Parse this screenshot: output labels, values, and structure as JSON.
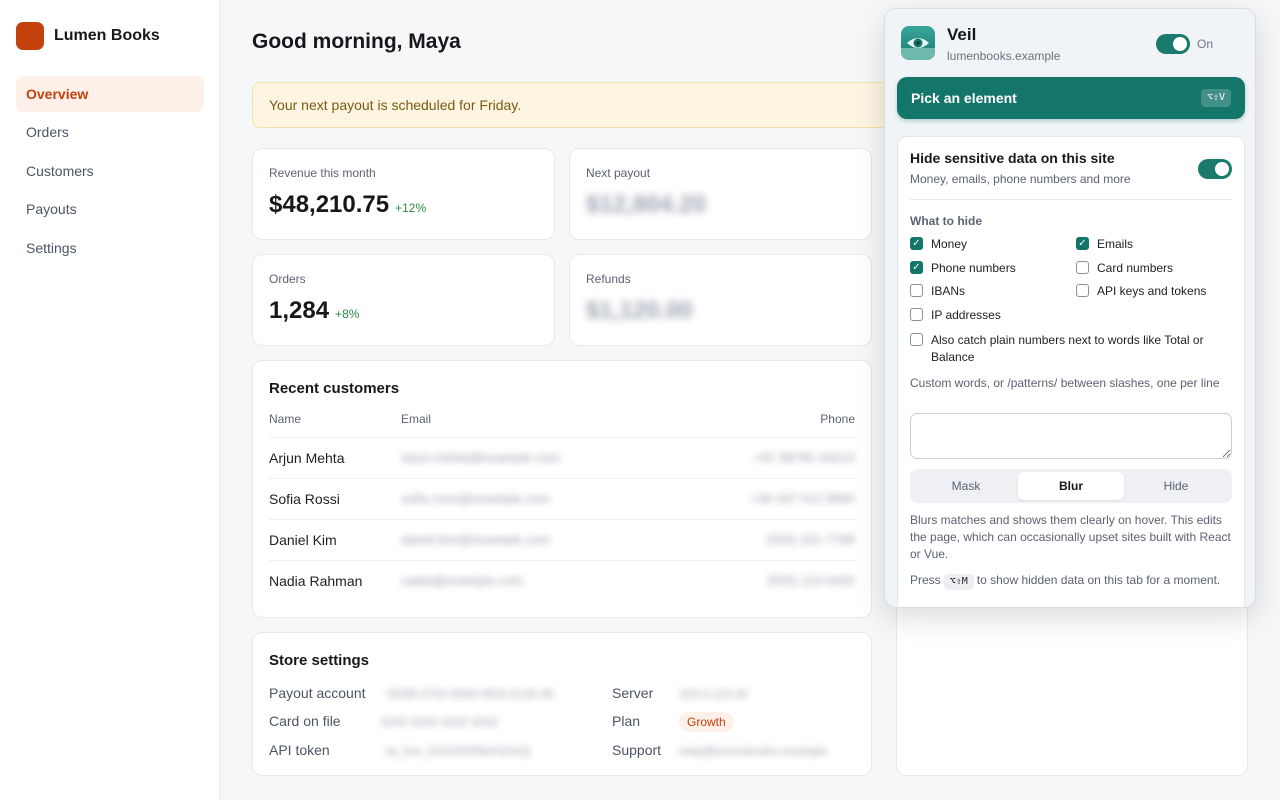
{
  "app": {
    "name": "Lumen Books"
  },
  "sidebar": {
    "items": [
      {
        "label": "Overview",
        "active": true
      },
      {
        "label": "Orders"
      },
      {
        "label": "Customers"
      },
      {
        "label": "Payouts"
      },
      {
        "label": "Settings"
      }
    ]
  },
  "main": {
    "greeting": "Good morning, Maya",
    "banner": "Your next payout is scheduled for Friday.",
    "stats": [
      {
        "label": "Revenue this month",
        "value": "$48,210.75",
        "delta": "+12%"
      },
      {
        "label": "Next payout",
        "value": "$12,804.20",
        "blurred": true
      },
      {
        "label": "Orders",
        "value": "1,284",
        "delta": "+8%"
      },
      {
        "label": "Refunds",
        "value": "$1,120.00",
        "blurred": true
      }
    ],
    "customers": {
      "title": "Recent customers",
      "columns": [
        "Name",
        "Email",
        "Phone"
      ],
      "rows": [
        {
          "name": "Arjun Mehta",
          "email": "arjun.mehta@example.com",
          "phone": "+91 98765 43210"
        },
        {
          "name": "Sofia Rossi",
          "email": "sofia.rossi@example.com",
          "phone": "+39 347 512 8890"
        },
        {
          "name": "Daniel Kim",
          "email": "daniel.kim@example.com",
          "phone": "(555) 201-7788"
        },
        {
          "name": "Nadia Rahman",
          "email": "nadia@example.com",
          "phone": "(555) 113-0420"
        }
      ]
    },
    "settings": {
      "title": "Store settings",
      "payout_account_label": "Payout account",
      "payout_account": "DE89 3704 0044 0532 0130 00",
      "card_label": "Card on file",
      "card": "4242 4242 4242 4242",
      "api_label": "API token",
      "api": "sk_live_51HzRXf9eKd2mQ",
      "server_label": "Server",
      "server": "203.0.113.42",
      "plan_label": "Plan",
      "plan": "Growth",
      "support_label": "Support",
      "support": "help@lumenbooks.example"
    }
  },
  "popup": {
    "title": "Veil",
    "domain": "lumenbooks.example",
    "enabled_label": "On",
    "pick_label": "Pick an element",
    "pick_shortcut": "⌥⇧V",
    "hide_title": "Hide sensitive data on this site",
    "hide_subtitle": "Money, emails, phone numbers and more",
    "what_to_hide": "What to hide",
    "options": [
      {
        "label": "Money",
        "checked": true
      },
      {
        "label": "Emails",
        "checked": true
      },
      {
        "label": "Phone numbers",
        "checked": true
      },
      {
        "label": "Card numbers",
        "checked": false
      },
      {
        "label": "IBANs",
        "checked": false
      },
      {
        "label": "API keys and tokens",
        "checked": false
      },
      {
        "label": "IP addresses",
        "checked": false
      },
      {
        "label": "Also catch plain numbers next to words like Total or Balance",
        "checked": false
      }
    ],
    "custom_label": "Custom words, or /patterns/ between slashes, one per line",
    "custom_value": "",
    "modes": [
      "Mask",
      "Blur",
      "Hide"
    ],
    "active_mode": "Blur",
    "mode_description": "Blurs matches and shows them clearly on hover. This edits the page, which can occasionally upset sites built with React or Vue.",
    "press_before": "Press",
    "press_shortcut": "⌥⇧M",
    "press_after": "to show hidden data on this tab for a moment."
  }
}
